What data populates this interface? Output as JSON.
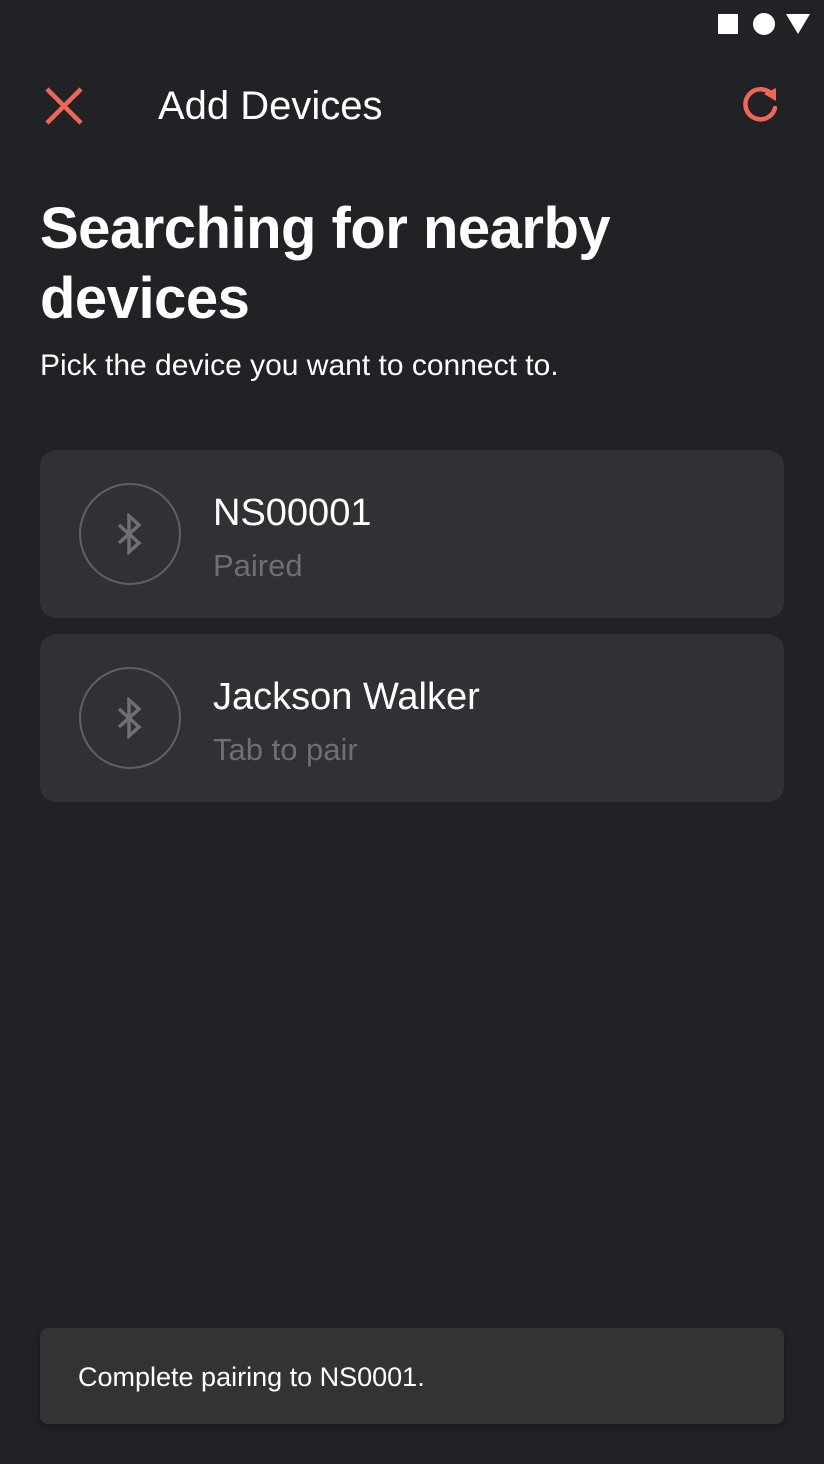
{
  "status_bar": {
    "icons": [
      "square-icon",
      "circle-icon",
      "triangle-icon"
    ]
  },
  "header": {
    "title": "Add Devices",
    "close_icon": "close-icon",
    "refresh_icon": "refresh-icon"
  },
  "main": {
    "heading": "Searching for nearby devices",
    "subheading": "Pick the device you want to connect to."
  },
  "devices": [
    {
      "name": "NS00001",
      "status": "Paired",
      "icon": "bluetooth-icon"
    },
    {
      "name": "Jackson Walker",
      "status": "Tab to pair",
      "icon": "bluetooth-icon"
    }
  ],
  "snackbar": {
    "message": "Complete pairing to NS0001."
  },
  "colors": {
    "background": "#212226",
    "card": "#303135",
    "accent": "#F2665A",
    "muted_text": "#6E6F73",
    "snackbar": "#333333"
  }
}
